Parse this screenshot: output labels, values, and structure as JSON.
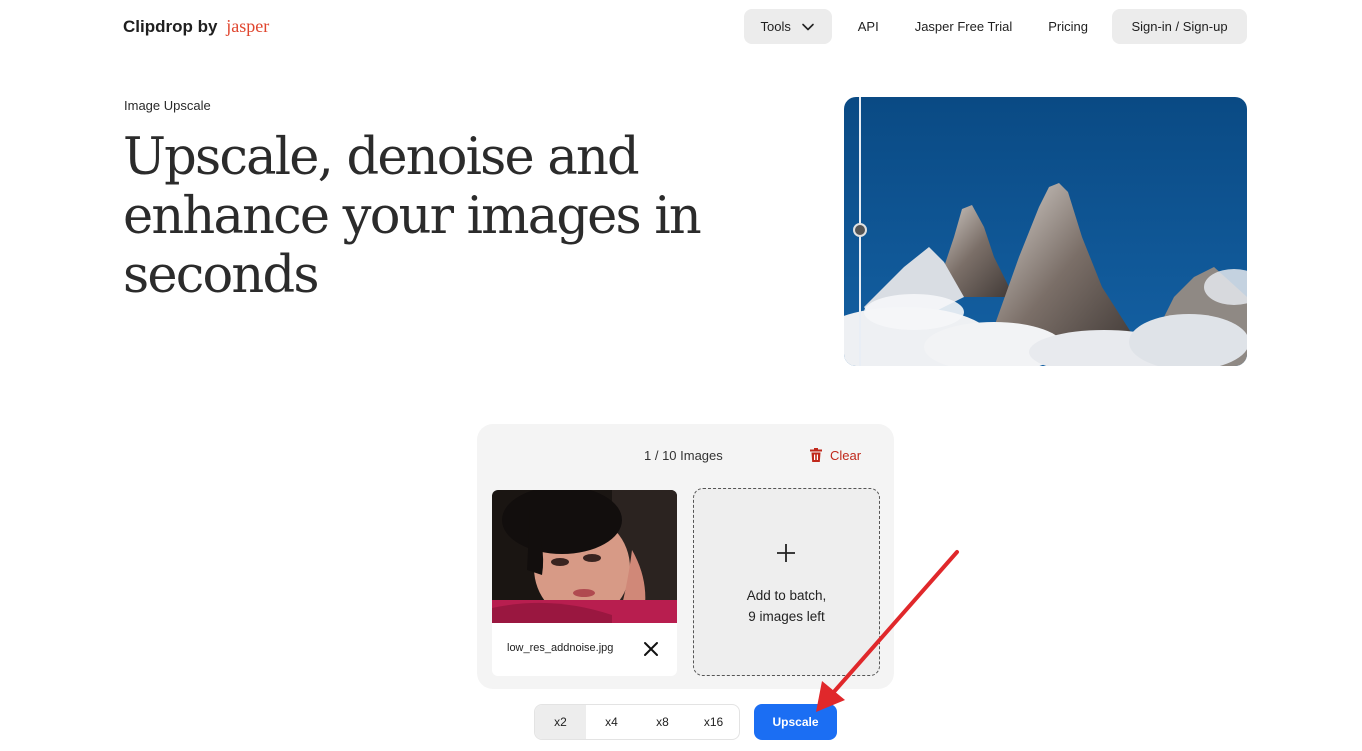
{
  "header": {
    "brand_name": "Clipdrop",
    "brand_by": "by",
    "brand_partner": "jasper",
    "nav": {
      "tools": "Tools",
      "api": "API",
      "trial": "Jasper Free Trial",
      "pricing": "Pricing",
      "signin": "Sign-in / Sign-up"
    }
  },
  "hero": {
    "eyebrow": "Image Upscale",
    "title": "Upscale, denoise and enhance your images in seconds"
  },
  "batch": {
    "count": "1 / 10 Images",
    "clear_label": "Clear",
    "file_name": "low_res_addnoise.jpg",
    "add_line1": "Add to batch,",
    "add_line2": "9 images left"
  },
  "scales": {
    "options": [
      "x2",
      "x4",
      "x8",
      "x16"
    ],
    "selected": "x2"
  },
  "actions": {
    "upscale": "Upscale"
  },
  "colors": {
    "accent": "#1b6ef3",
    "brand_partner": "#e0452e",
    "danger": "#c0281b",
    "annotation_arrow": "#e0282b"
  }
}
